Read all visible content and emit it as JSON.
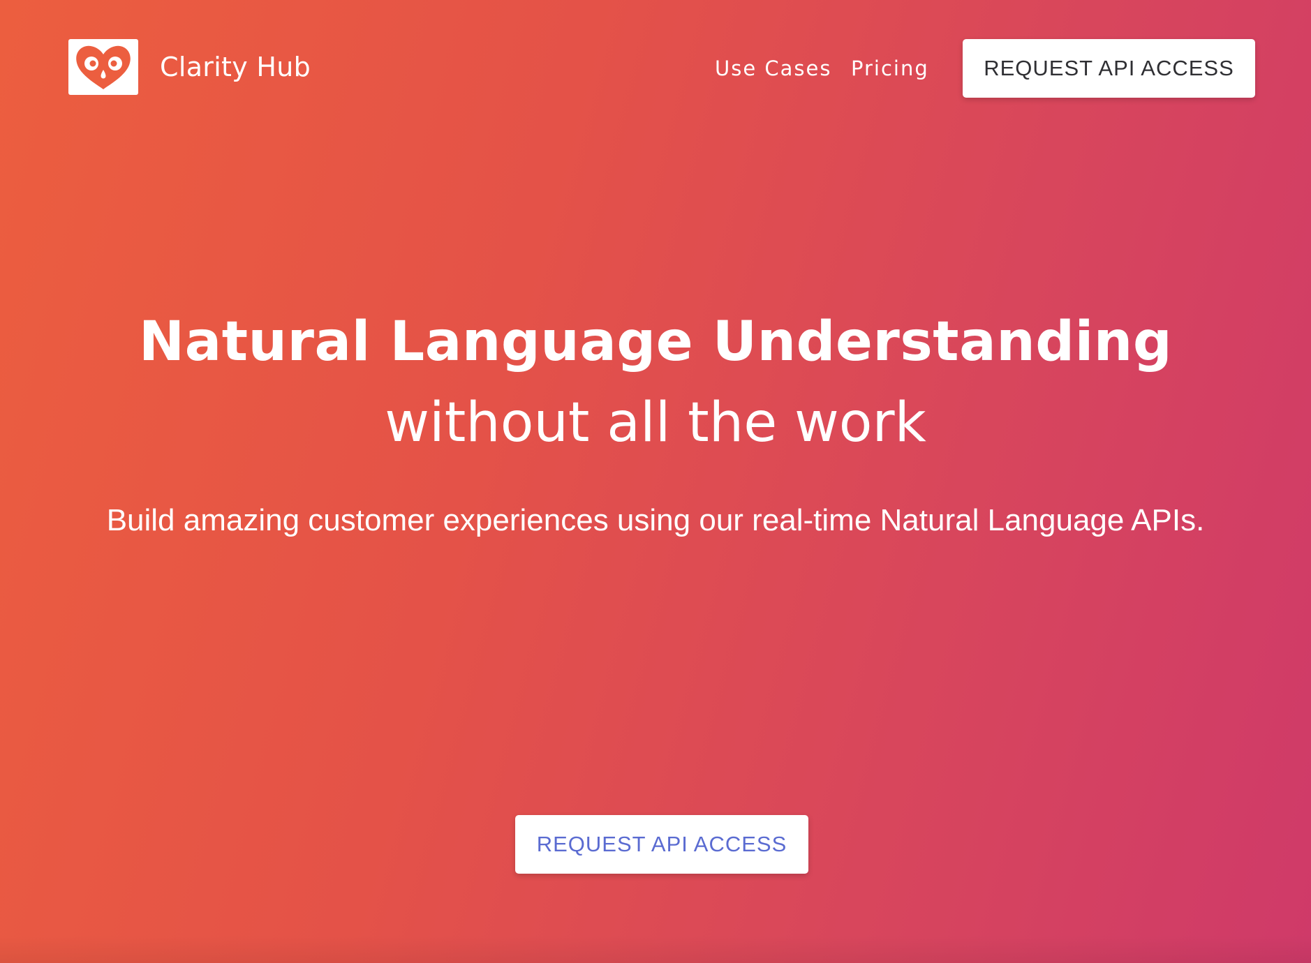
{
  "brand": {
    "name": "Clarity Hub",
    "logo_icon": "heart-face-icon"
  },
  "nav": {
    "links": [
      "Use Cases",
      "Pricing"
    ],
    "cta_label": "REQUEST API ACCESS"
  },
  "hero": {
    "headline": "Natural Language Understanding",
    "subheadline": "without all the work",
    "description": "Build amazing customer experiences using our real-time Natural Language APIs.",
    "cta_label": "REQUEST API ACCESS"
  },
  "colors": {
    "gradient_start": "#ec5e3f",
    "gradient_end": "#cf3a69",
    "cta_text": "#5a6bd1",
    "header_button_text": "#2f2f33"
  }
}
